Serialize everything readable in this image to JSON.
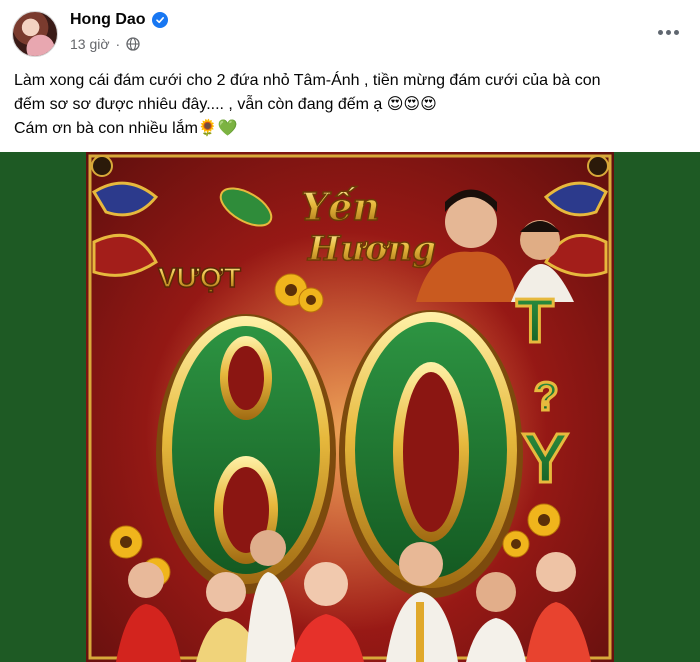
{
  "post": {
    "author": "Hong Dao",
    "time": "13 giờ",
    "text_line1": "Làm xong cái đám cưới cho 2 đứa nhỏ Tâm-Ánh , tiền mừng đám cưới của bà con",
    "text_line2": "đếm sơ sơ được nhiêu đây.... , vẫn còn đang đếm ạ 😍😍😍",
    "text_line3": "Cám ơn bà con nhiều lắm🌻💚"
  },
  "poster": {
    "movie_title": "Yến Hương",
    "vuot": "VƯỢT",
    "big_number": "80",
    "ty_letters": [
      "T",
      "ỷ",
      "Y"
    ]
  },
  "colors": {
    "facebook_blue": "#1877f2",
    "media_background": "#1e5a24",
    "poster_green": "#1f7a32",
    "poster_red": "#b11d1a",
    "poster_gold": "#e7b93d"
  }
}
